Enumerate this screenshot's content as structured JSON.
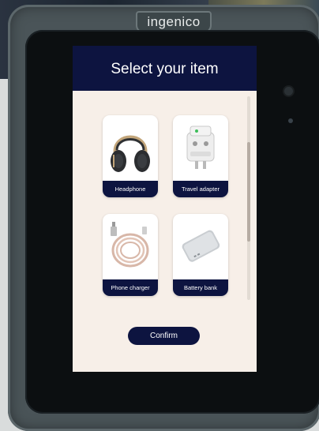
{
  "device": {
    "brand": "ingenico"
  },
  "screen": {
    "title": "Select your item",
    "items": [
      {
        "label": "Headphone",
        "icon": "headphone-icon"
      },
      {
        "label": "Travel adapter",
        "icon": "travel-adapter-icon"
      },
      {
        "label": "Phone charger",
        "icon": "phone-charger-icon"
      },
      {
        "label": "Battery bank",
        "icon": "battery-bank-icon"
      }
    ],
    "confirm_label": "Confirm"
  },
  "colors": {
    "header": "#0d1440",
    "screen_bg": "#f7efe8",
    "device_body": "#4a5458"
  }
}
